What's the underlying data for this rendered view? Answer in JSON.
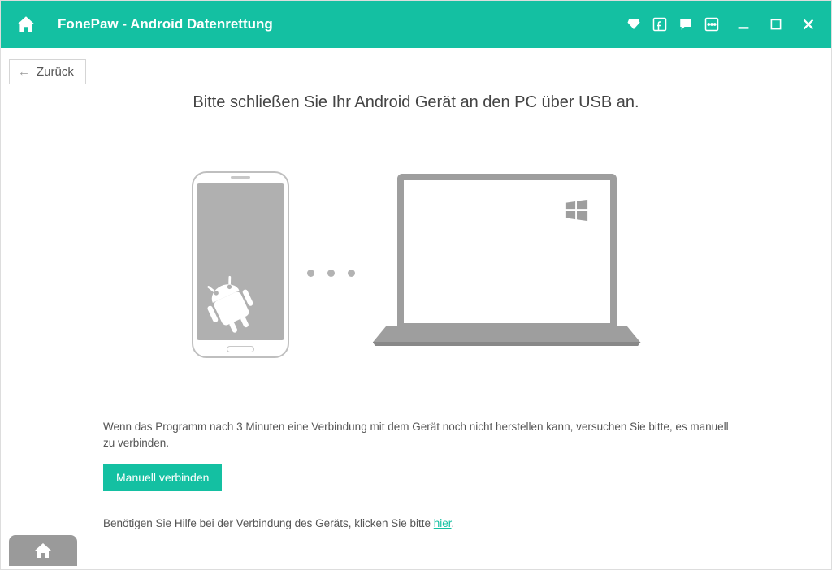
{
  "header": {
    "title": "FonePaw - Android Datenrettung"
  },
  "back": {
    "label": "Zurück"
  },
  "main": {
    "heading": "Bitte schließen Sie Ihr Android Gerät an den PC über USB an.",
    "info_text": "Wenn das Programm nach 3 Minuten eine Verbindung mit dem Gerät noch nicht herstellen kann, versuchen Sie bitte, es manuell zu verbinden.",
    "manual_button": "Manuell verbinden",
    "help_prefix": "Benötigen Sie Hilfe bei der Verbindung des Geräts, klicken Sie bitte ",
    "help_link": "hier",
    "help_suffix": "."
  }
}
